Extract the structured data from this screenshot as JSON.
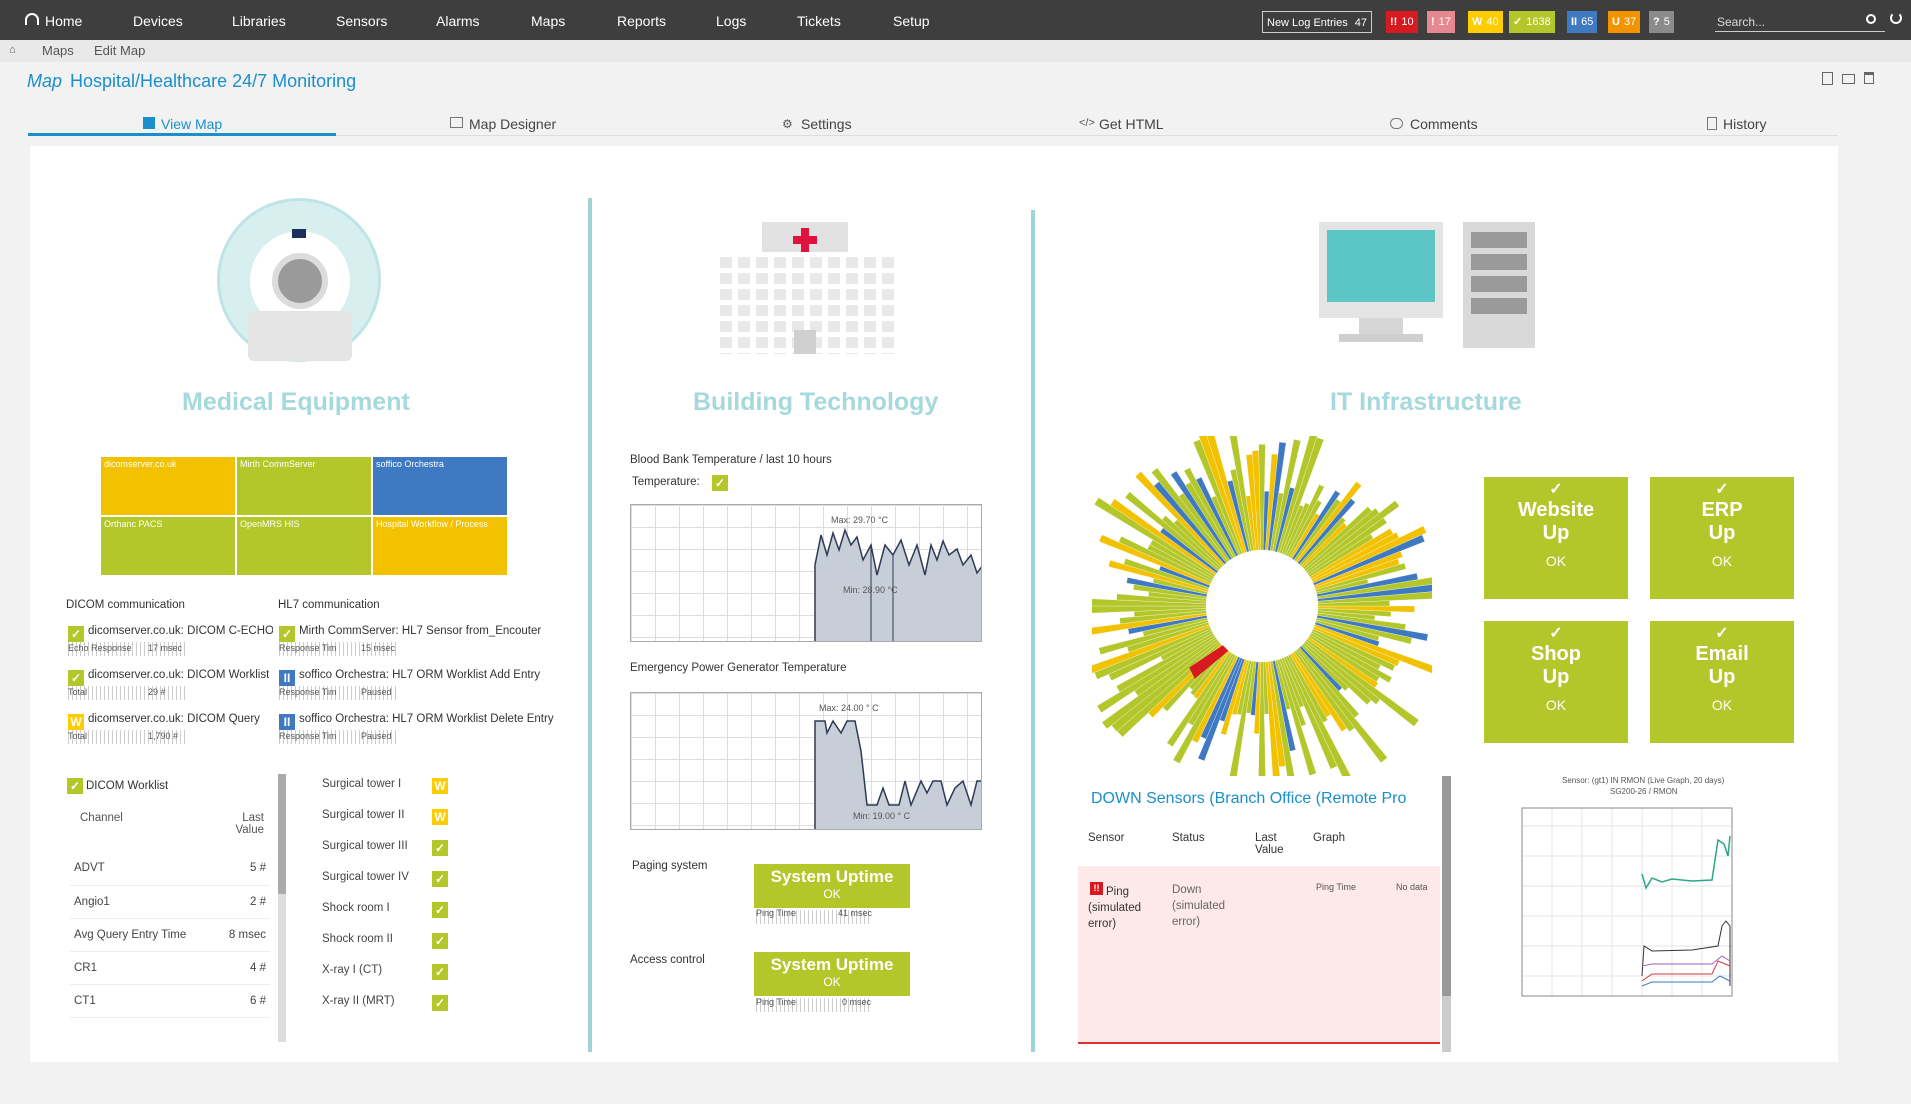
{
  "nav": {
    "items": [
      "Home",
      "Devices",
      "Libraries",
      "Sensors",
      "Alarms",
      "Maps",
      "Reports",
      "Logs",
      "Tickets",
      "Setup"
    ],
    "log_entries_label": "New Log Entries",
    "log_entries_count": "47",
    "badges": [
      {
        "icon": "!!",
        "count": "10",
        "color": "#d71920"
      },
      {
        "icon": "!",
        "count": "17",
        "color": "#e5888f"
      },
      {
        "icon": "W",
        "count": "40",
        "color": "#ffcc00"
      },
      {
        "icon": "✓",
        "count": "1638",
        "color": "#b3c72a"
      },
      {
        "icon": "II",
        "count": "65",
        "color": "#3e79c2"
      },
      {
        "icon": "U",
        "count": "37",
        "color": "#f29400"
      },
      {
        "icon": "?",
        "count": "5",
        "color": "#8b8b8b"
      }
    ],
    "search_placeholder": "Search..."
  },
  "breadcrumb": {
    "items": [
      "Maps",
      "Edit Map"
    ]
  },
  "page": {
    "prefix": "Map",
    "title": "Hospital/Healthcare 24/7 Monitoring"
  },
  "tabs": [
    "View Map",
    "Map Designer",
    "Settings",
    "Get HTML",
    "Comments",
    "History"
  ],
  "medical": {
    "title": "Medical Equipment",
    "heatmap": [
      {
        "label": "dicomserver.co.uk",
        "color": "#f2c200"
      },
      {
        "label": "Mirth CommServer",
        "color": "#b3c72a"
      },
      {
        "label": "soffico Orchestra",
        "color": "#3e79c2"
      },
      {
        "label": "Orthanc PACS",
        "color": "#b3c72a"
      },
      {
        "label": "OpenMRS HIS",
        "color": "#b3c72a"
      },
      {
        "label": "Hospital Workflow / Process",
        "color": "#f2c200"
      }
    ],
    "dicom_heading": "DICOM communication",
    "hl7_heading": "HL7 communication",
    "dicom": [
      {
        "name": "dicomserver.co.uk: DICOM C-ECHO",
        "sub": "Echo Response",
        "val": "17 msec",
        "state": "ok"
      },
      {
        "name": "dicomserver.co.uk: DICOM Worklist",
        "sub": "Total",
        "val": "29 #",
        "state": "ok"
      },
      {
        "name": "dicomserver.co.uk: DICOM Query",
        "sub": "Total",
        "val": "1,790 #",
        "state": "warn"
      }
    ],
    "hl7": [
      {
        "name": "Mirth CommServer: HL7 Sensor from_Encouter",
        "sub": "Response Tim",
        "val": "15 msec",
        "state": "ok"
      },
      {
        "name": "soffico Orchestra: HL7 ORM Worklist Add Entry",
        "sub": "Response Tim",
        "val": "Paused",
        "state": "paused"
      },
      {
        "name": "soffico Orchestra: HL7 ORM Worklist Delete Entry",
        "sub": "Response Tim",
        "val": "Paused",
        "state": "paused"
      }
    ],
    "worklist_title": "DICOM Worklist",
    "worklist_cols": [
      "Channel",
      "Last Value"
    ],
    "worklist_rows": [
      {
        "channel": "ADVT",
        "value": "5 #"
      },
      {
        "channel": "Angio1",
        "value": "2 #"
      },
      {
        "channel": "Avg Query Entry Time",
        "value": "8 msec"
      },
      {
        "channel": "CR1",
        "value": "4 #"
      },
      {
        "channel": "CT1",
        "value": "6 #"
      }
    ],
    "rooms": [
      {
        "name": "Surgical tower I",
        "state": "warn"
      },
      {
        "name": "Surgical tower II",
        "state": "warn"
      },
      {
        "name": "Surgical tower III",
        "state": "ok"
      },
      {
        "name": "Surgical tower IV",
        "state": "ok"
      },
      {
        "name": "Shock room I",
        "state": "ok"
      },
      {
        "name": "Shock room II",
        "state": "ok"
      },
      {
        "name": "X-ray I (CT)",
        "state": "ok"
      },
      {
        "name": "X-ray II (MRT)",
        "state": "ok"
      }
    ]
  },
  "building": {
    "title": "Building Technology",
    "blood_title": "Blood Bank Temperature / last 10 hours",
    "temp_label": "Temperature:",
    "blood_max": "Max: 29.70 °C",
    "blood_min": "Min: 28.90 °C",
    "gen_title": "Emergency Power Generator Temperature",
    "gen_max": "Max: 24.00 ° C",
    "gen_min": "Min: 19.00 ° C",
    "paging_label": "Paging system",
    "access_label": "Access control",
    "uptime_title": "System Uptime",
    "uptime_status": "OK",
    "paging_spark_label": "Ping Time",
    "paging_spark_val": "41 msec",
    "access_spark_label": "Ping Time",
    "access_spark_val": "0 msec"
  },
  "it": {
    "title": "IT Infrastructure",
    "tiles": [
      {
        "l1": "Website",
        "l2": "Up",
        "status": "OK"
      },
      {
        "l1": "ERP",
        "l2": "Up",
        "status": "OK"
      },
      {
        "l1": "Shop",
        "l2": "Up",
        "status": "OK"
      },
      {
        "l1": "Email",
        "l2": "Up",
        "status": "OK"
      }
    ],
    "down_title": "DOWN Sensors (Branch Office (Remote Pro",
    "down_cols": [
      "Sensor",
      "Status",
      "Last Value",
      "Graph"
    ],
    "down_rows": [
      {
        "sensor": "Ping (simulated error)",
        "status": "Down (simulated error)",
        "graph": "Ping Time",
        "data": "No data"
      }
    ],
    "graph_title": "Sensor: (gt1) IN RMON (Live Graph, 20 days)",
    "graph_sub": "SG200-26 / RMON"
  },
  "colors": {
    "accent": "#1a8fc9",
    "ok": "#b3c72a",
    "warn": "#ffcc00",
    "down": "#d71920",
    "paused": "#3e79c2",
    "teal": "#a6d9dc"
  }
}
